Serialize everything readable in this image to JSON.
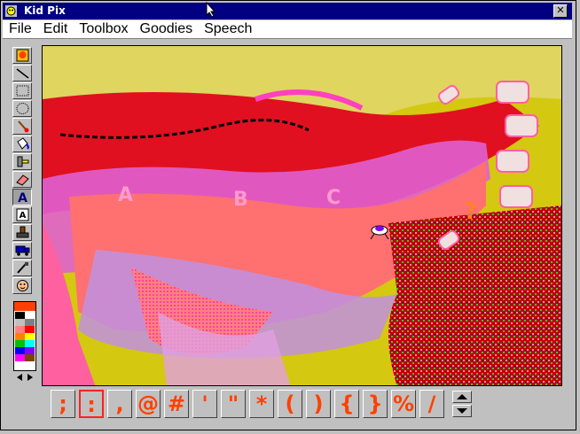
{
  "window": {
    "title": "Kid Pix",
    "close_label": "✕"
  },
  "menu": [
    "File",
    "Edit",
    "Toolbox",
    "Goodies",
    "Speech"
  ],
  "tools": [
    {
      "name": "undo-guy-icon"
    },
    {
      "name": "line-tool-icon"
    },
    {
      "name": "rectangle-tool-icon"
    },
    {
      "name": "oval-tool-icon"
    },
    {
      "name": "paintbrush-tool-icon"
    },
    {
      "name": "paint-bucket-tool-icon"
    },
    {
      "name": "wacky-brush-icon"
    },
    {
      "name": "eraser-tool-icon"
    },
    {
      "name": "text-tool-icon"
    },
    {
      "name": "alphabet-stamp-icon"
    },
    {
      "name": "rubber-stamp-icon"
    },
    {
      "name": "moving-van-icon"
    },
    {
      "name": "eyedropper-tool-icon"
    },
    {
      "name": "face-icon"
    }
  ],
  "colors": {
    "selected": "#ff4000",
    "palette": [
      "#000000",
      "#ffffff",
      "#c0c0c0",
      "#808080",
      "#ff8080",
      "#ff0000",
      "#ff8000",
      "#ffff00",
      "#00c000",
      "#00ffff",
      "#0000ff",
      "#8000ff",
      "#ff00ff",
      "#804000"
    ]
  },
  "characters": [
    ";",
    ":",
    ",",
    "@",
    "#",
    "'",
    "\"",
    "*",
    "(",
    ")",
    "{",
    "}",
    "%",
    "/"
  ],
  "selected_character": ":"
}
